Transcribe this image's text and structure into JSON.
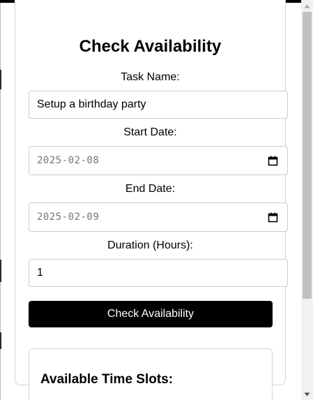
{
  "form": {
    "title": "Check Availability",
    "task_name_label": "Task Name:",
    "task_name_value": "Setup a birthday party",
    "start_date_label": "Start Date:",
    "start_date_value": "2025-02-08",
    "end_date_label": "End Date:",
    "end_date_value": "2025-02-09",
    "duration_label": "Duration (Hours):",
    "duration_value": "1",
    "submit_label": "Check Availability"
  },
  "results": {
    "title": "Available Time Slots:"
  },
  "icons": {
    "date_picker": "calendar-icon",
    "scroll_up": "triangle-up-icon",
    "scroll_down": "triangle-down-icon"
  },
  "colors": {
    "primary_button_bg": "#000000",
    "primary_button_text": "#ffffff",
    "border": "#cccccc",
    "date_text": "#757575"
  }
}
